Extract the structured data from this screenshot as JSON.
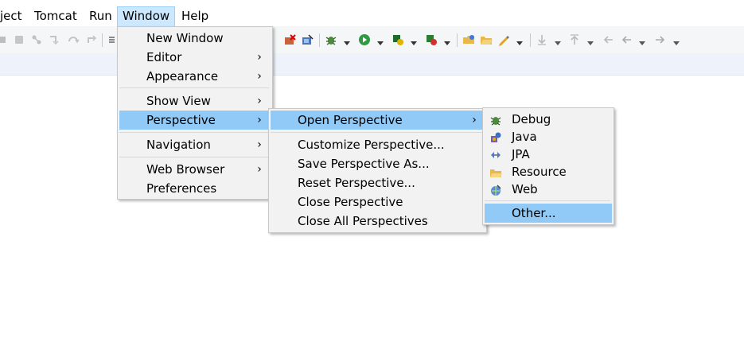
{
  "menubar": {
    "items": [
      "ject",
      "Tomcat",
      "Run",
      "Window",
      "Help"
    ],
    "active": "Window"
  },
  "window_menu": {
    "items": [
      {
        "label": "New Window",
        "submenu": false
      },
      {
        "label": "Editor",
        "submenu": true
      },
      {
        "label": "Appearance",
        "submenu": true
      },
      {
        "label": "Show View",
        "submenu": true
      },
      {
        "label": "Perspective",
        "submenu": true,
        "highlighted": true
      },
      {
        "label": "Navigation",
        "submenu": true
      },
      {
        "label": "Web Browser",
        "submenu": true
      },
      {
        "label": "Preferences",
        "submenu": false
      }
    ]
  },
  "perspective_menu": {
    "items": [
      {
        "label": "Open Perspective",
        "submenu": true,
        "highlighted": true
      },
      {
        "label": "Customize Perspective...",
        "submenu": false
      },
      {
        "label": "Save Perspective As...",
        "submenu": false
      },
      {
        "label": "Reset Perspective...",
        "submenu": false
      },
      {
        "label": "Close Perspective",
        "submenu": false
      },
      {
        "label": "Close All Perspectives",
        "submenu": false
      }
    ]
  },
  "open_perspective_menu": {
    "items": [
      {
        "label": "Debug",
        "icon": "debug-bug-icon"
      },
      {
        "label": "Java",
        "icon": "java-perspective-icon"
      },
      {
        "label": "JPA",
        "icon": "jpa-icon"
      },
      {
        "label": "Resource",
        "icon": "folder-resource-icon"
      },
      {
        "label": "Web",
        "icon": "web-globe-icon"
      },
      {
        "label": "Other...",
        "highlighted": true
      }
    ]
  },
  "glyphs": {
    "submenu_arrow": "›"
  },
  "colors": {
    "menu_highlight": "#91c9f7",
    "menubar_active": "#cce8ff",
    "menu_background": "#f2f2f2"
  }
}
